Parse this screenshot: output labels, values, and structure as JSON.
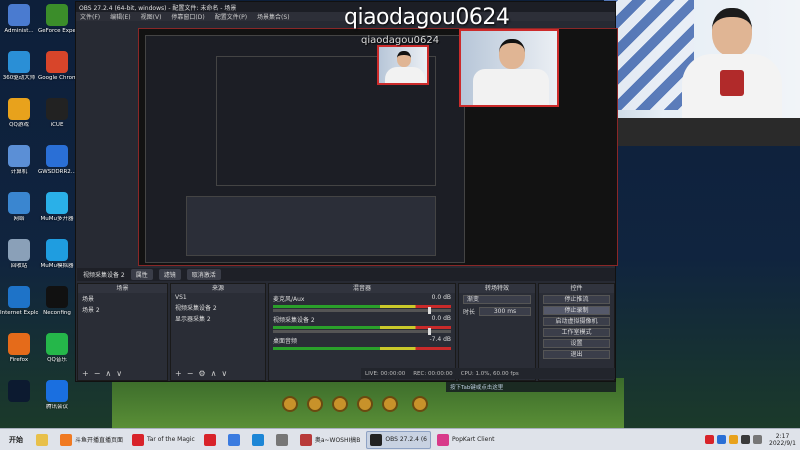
{
  "desktop_icons": [
    {
      "label": "Administ...",
      "icon": "user-folder-icon",
      "color": "#4a7bd0"
    },
    {
      "label": "GeForce Experience",
      "icon": "nvidia-icon",
      "color": "#3b8d2a"
    },
    {
      "label": "360驱动大师",
      "icon": "driver-icon",
      "color": "#2a8fd6"
    },
    {
      "label": "Google Chrome",
      "icon": "chrome-icon",
      "color": "#d8452a"
    },
    {
      "label": "QQ游戏",
      "icon": "qq-game-icon",
      "color": "#e8a21c"
    },
    {
      "label": "iCUE",
      "icon": "icue-icon",
      "color": "#222"
    },
    {
      "label": "计算机",
      "icon": "computer-icon",
      "color": "#5b8fd6"
    },
    {
      "label": "GWSDDRR2...",
      "icon": "blue-square-icon",
      "color": "#2a6fd6"
    },
    {
      "label": "网络",
      "icon": "network-icon",
      "color": "#3a86d0"
    },
    {
      "label": "MuMu多开器",
      "icon": "mumu-icon",
      "color": "#2ab0e8"
    },
    {
      "label": "回收站",
      "icon": "recycle-bin-icon",
      "color": "#8aa0b8"
    },
    {
      "label": "MuMu模拟器",
      "icon": "mumu-emulator-icon",
      "color": "#1f9de0"
    },
    {
      "label": "Internet Explorer",
      "icon": "ie-icon",
      "color": "#1e73c8"
    },
    {
      "label": "Neconfing",
      "icon": "p-icon",
      "color": "#111"
    },
    {
      "label": "Firefox",
      "icon": "firefox-icon",
      "color": "#e56b1a"
    },
    {
      "label": "QQ音乐",
      "icon": "qq-music-icon",
      "color": "#25b74a"
    },
    {
      "label": "",
      "icon": "blank-icon",
      "color": "#0c1a30"
    },
    {
      "label": "腾讯会议",
      "icon": "tencent-meeting-icon",
      "color": "#1a6fe0"
    }
  ],
  "watermark": "qiaodagou0624",
  "watermark_small": "qiaodagou0624",
  "obs": {
    "title": "OBS 27.2.4 (64-bit, windows) - 配置文件: 未命名 - 场景",
    "menu": [
      "文件(F)",
      "编辑(E)",
      "视图(V)",
      "停靠窗口(D)",
      "配置文件(P)",
      "场景集合(S)"
    ],
    "source_bar": {
      "label": "视频采集设备 2",
      "buttons": [
        "属性",
        "滤镜",
        "取消激活"
      ]
    },
    "scenes": {
      "title": "场景",
      "items": [
        "场景",
        "场景 2"
      ]
    },
    "sources": {
      "title": "来源",
      "items": [
        "VS1",
        "视频采集设备 2",
        "显示器采集 2"
      ]
    },
    "mixer": {
      "title": "混音器",
      "channels": [
        {
          "name": "麦克风/Aux",
          "db": "0.0 dB"
        },
        {
          "name": "视频采集设备 2",
          "db": "0.0 dB"
        },
        {
          "name": "桌面音频",
          "db": "-7.4 dB"
        }
      ]
    },
    "transitions": {
      "title": "转场特效",
      "type": "渐变",
      "duration_label": "时长",
      "duration": "300 ms"
    },
    "controls": {
      "title": "控件",
      "buttons": [
        "停止推流",
        "停止录制",
        "启动虚拟摄像机",
        "工作室模式",
        "设置",
        "退出"
      ]
    },
    "status": {
      "live": "LIVE: 00:00:00",
      "rec": "REC: 00:00:00",
      "cpu": "CPU: 1.0%, 60.00 fps"
    }
  },
  "notice": "按下Tab键或点击这里",
  "taskbar": {
    "start": "开始",
    "items": [
      {
        "label": "",
        "icon": "explorer-icon",
        "color": "#e8c04a"
      },
      {
        "label": "斗鱼开播直播页面",
        "icon": "douyu-icon",
        "color": "#f07a22"
      },
      {
        "label": "Tar of the Magic",
        "icon": "netease-icon",
        "color": "#d8232a"
      },
      {
        "label": "",
        "icon": "red-app-icon",
        "color": "#d8232a"
      },
      {
        "label": "",
        "icon": "feishu-icon",
        "color": "#3a7be0"
      },
      {
        "label": "",
        "icon": "blue-circle-icon",
        "color": "#1d86d6"
      },
      {
        "label": "",
        "icon": "avatar-icon",
        "color": "#777"
      },
      {
        "label": "奥a~WOSHI搞B",
        "icon": "game-icon",
        "color": "#b83a3a"
      },
      {
        "label": "OBS 27.2.4 (6",
        "icon": "obs-icon",
        "color": "#222"
      },
      {
        "label": "PopKart Client",
        "icon": "popkart-icon",
        "color": "#d83a8a"
      }
    ],
    "time": "2:17",
    "date": "2022/9/1"
  }
}
